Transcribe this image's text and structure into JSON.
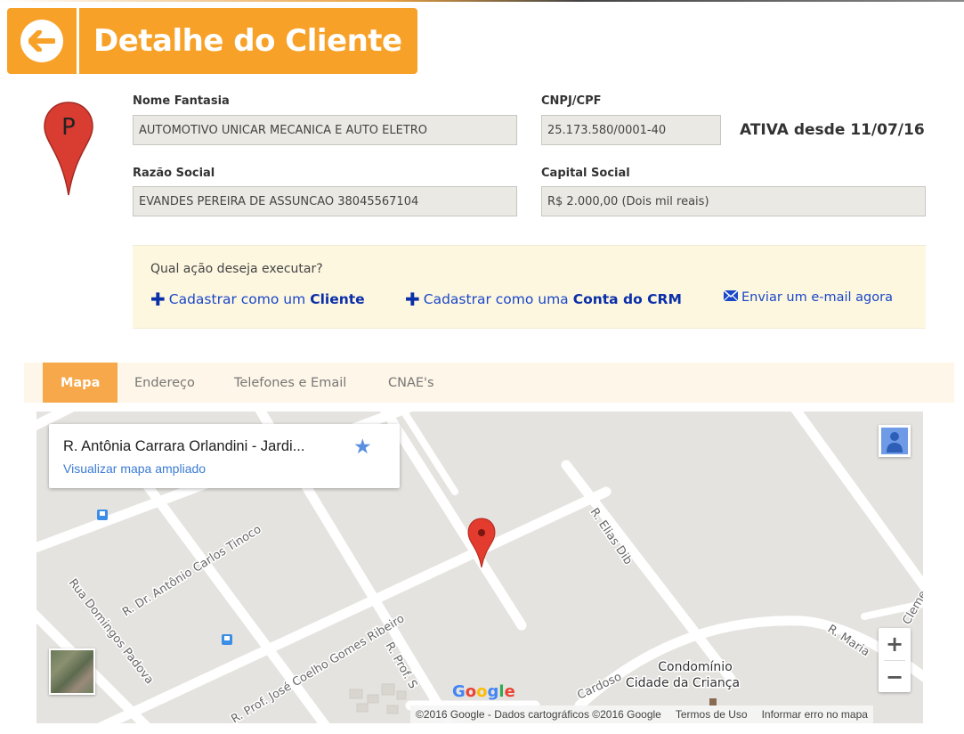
{
  "header": {
    "title": "Detalhe do Cliente"
  },
  "fields": {
    "nome_fantasia": {
      "label": "Nome Fantasia",
      "value": "AUTOMOTIVO UNICAR MECANICA E AUTO ELETRO"
    },
    "cnpj": {
      "label": "CNPJ/CPF",
      "value": "25.173.580/0001-40"
    },
    "razao_social": {
      "label": "Razão Social",
      "value": "EVANDES PEREIRA DE ASSUNCAO 38045567104"
    },
    "capital_social": {
      "label": "Capital Social",
      "value": "R$ 2.000,00 (Dois mil reais)"
    },
    "status": "ATIVA desde 11/07/16"
  },
  "pin_letter": "P",
  "actions": {
    "question": "Qual ação deseja executar?",
    "cliente_prefix": "Cadastrar como um",
    "cliente_bold": "Cliente",
    "crm_prefix": "Cadastrar como uma",
    "crm_bold": "Conta do CRM",
    "email": "Enviar um e-mail agora"
  },
  "tabs": [
    {
      "label": "Mapa",
      "active": true
    },
    {
      "label": "Endereço"
    },
    {
      "label": "Telefones e Email"
    },
    {
      "label": "CNAE's"
    }
  ],
  "map": {
    "place_title": "R. Antônia Carrara Orlandini - Jardi...",
    "view_larger": "Visualizar mapa ampliado",
    "streets": {
      "s1": "R. Dr. Antônio Carlos Tinoco",
      "s2": "Rua Domingos Padova",
      "s3": "R. Prof. José Coelho Gomes Ribeiro",
      "s4": "R. Elias Dib",
      "s5": "R. Prof. S",
      "s6": "R. Maria",
      "s7": "Cardoso",
      "s8": "Cleme"
    },
    "poi_line1": "Condomínio",
    "poi_line2": "Cidade da Criança",
    "google": "Google",
    "zoom_in": "+",
    "zoom_out": "−",
    "footer": {
      "copyright": "©2016 Google - Dados cartográficos ©2016 Google",
      "terms": "Termos de Uso",
      "report": "Informar erro no mapa"
    }
  },
  "colors": {
    "accent": "#f7a128",
    "link": "#1a47c8",
    "panel": "#fdf7e0",
    "pin": "#d93d32"
  }
}
